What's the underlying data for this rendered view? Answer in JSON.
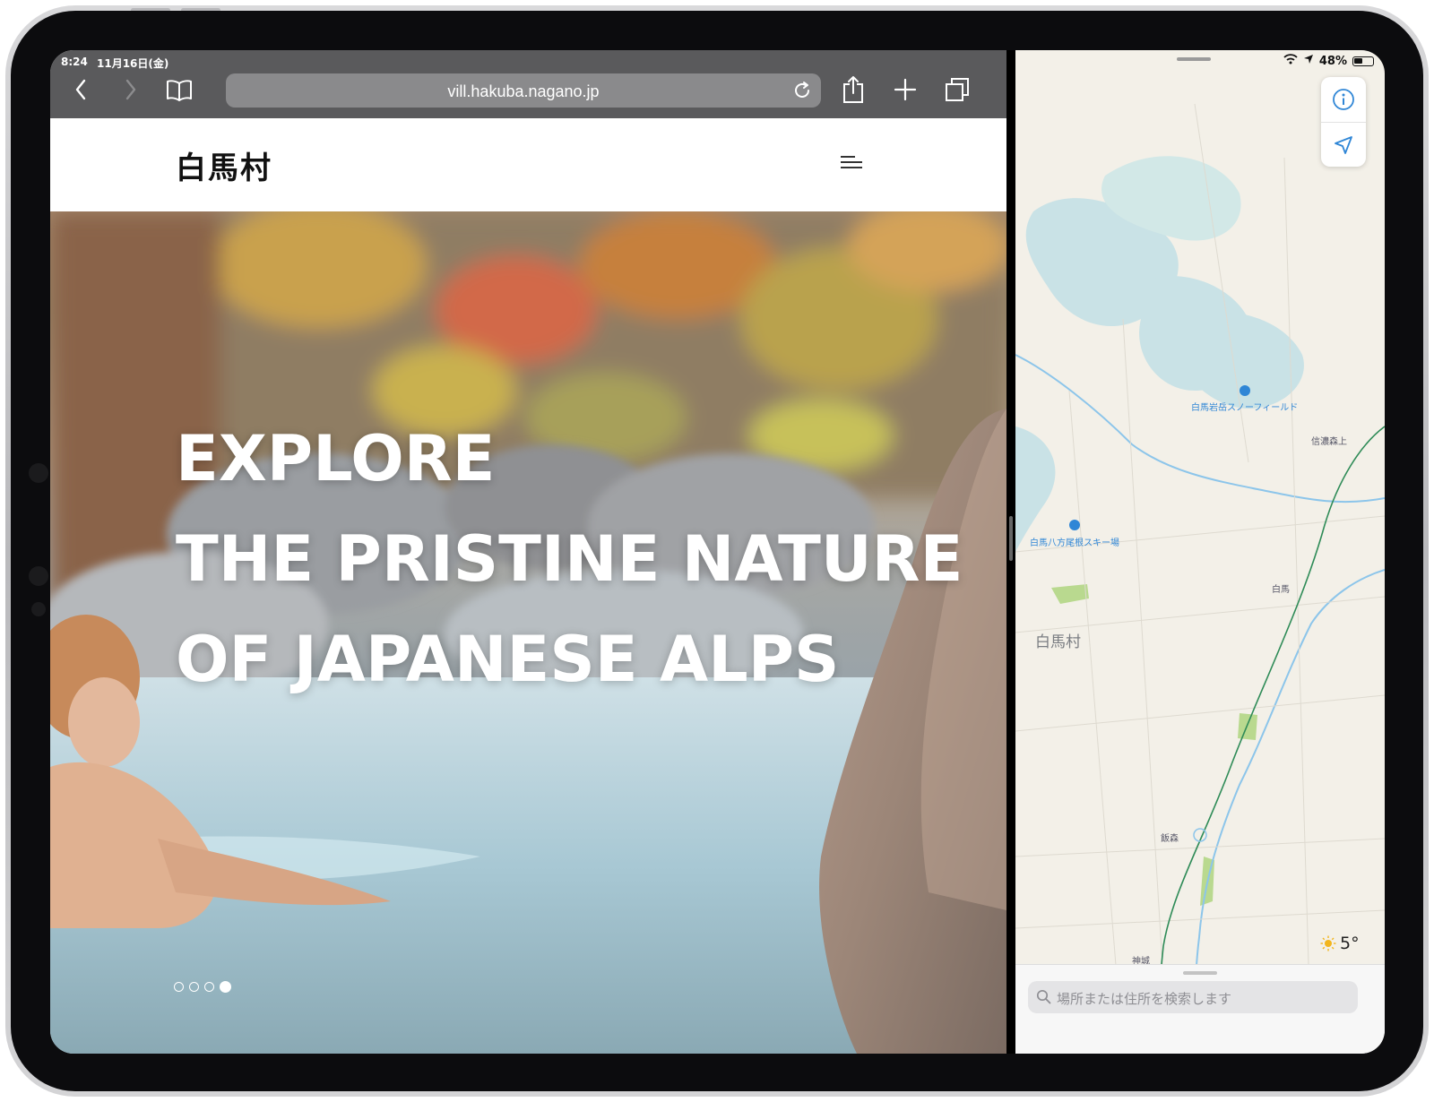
{
  "device": {
    "frame_color": "#0c0c0e"
  },
  "status_bar": {
    "time": "8:24",
    "date": "11月16日(金)",
    "battery_percent": "48%"
  },
  "safari": {
    "url": "vill.hakuba.nagano.jp",
    "icons": [
      "back-icon",
      "forward-icon",
      "bookmarks-icon",
      "reload-icon",
      "share-icon",
      "new-tab-icon",
      "tabs-icon"
    ]
  },
  "website": {
    "logo": "白馬村",
    "hero": {
      "line1": "EXPLORE",
      "line2": "THE PRISTINE NATURE",
      "line3": "OF JAPANESE ALPS"
    },
    "slides": {
      "total": 4,
      "active": 4
    }
  },
  "maps": {
    "labels": {
      "iwatake": "白馬岩岳スノーフィールド",
      "shinanomoriue": "信濃森上",
      "happo": "白馬八方尾根スキー場",
      "hakuba_station": "白馬",
      "village": "白馬村",
      "iimori": "飯森",
      "kamishiro": "神城"
    },
    "weather": {
      "temperature": "5°",
      "icon": "sun-icon"
    },
    "search_placeholder": "場所または住所を検索します",
    "colors": {
      "land": "#f3f0e8",
      "water": "#c9e2e6",
      "park": "#b9d98f",
      "railway": "#2e8b57",
      "river": "#8cc5ea"
    }
  }
}
